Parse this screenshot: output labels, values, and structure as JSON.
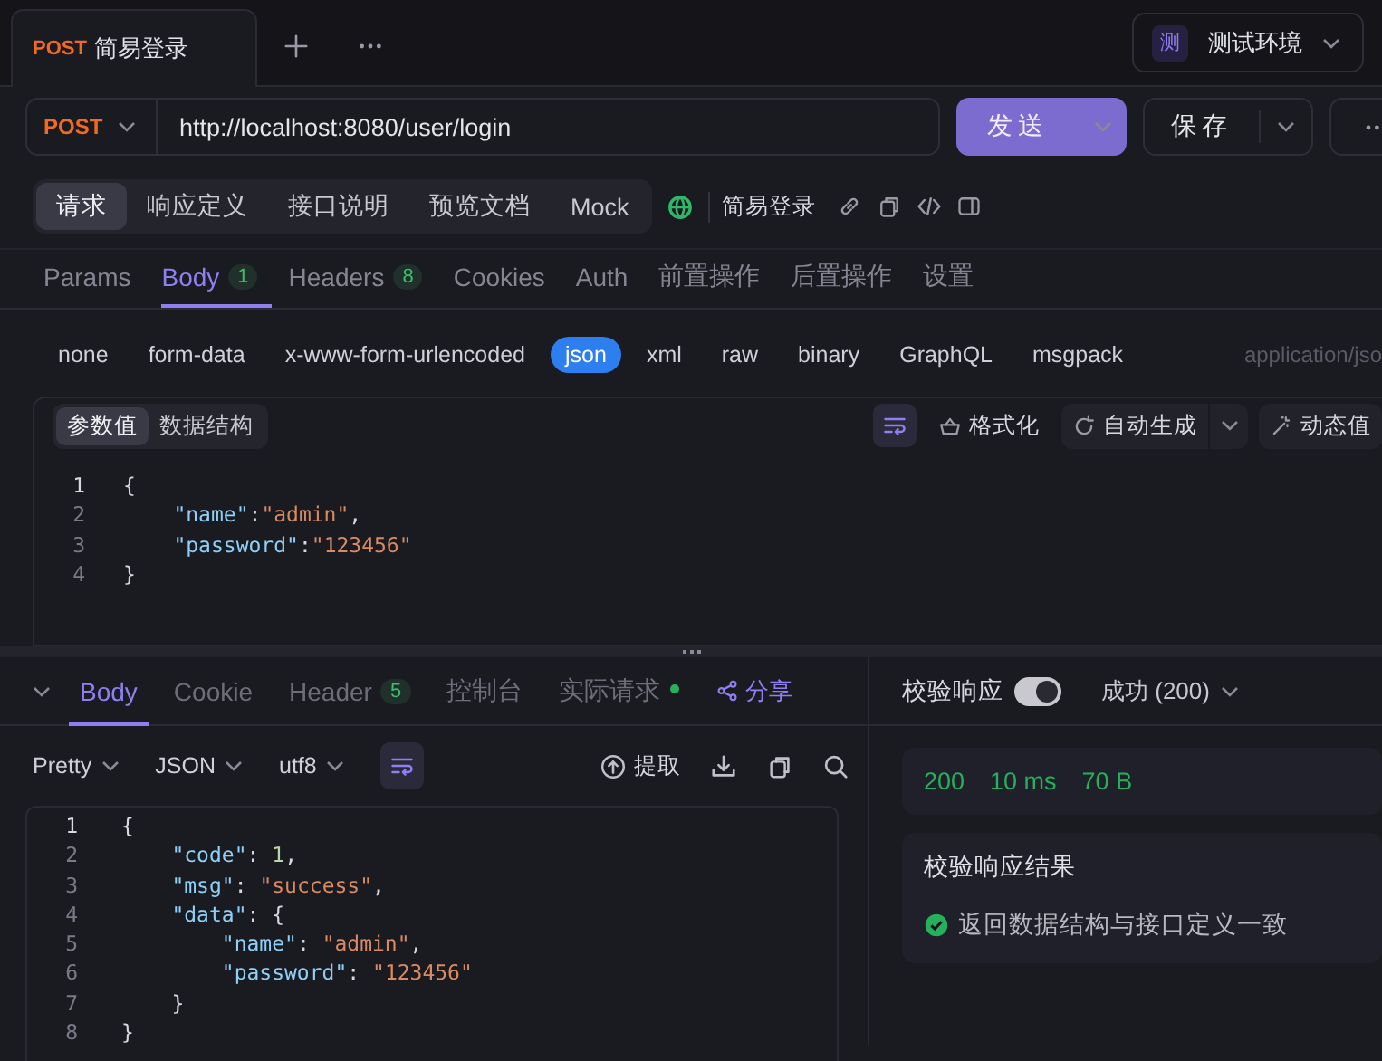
{
  "tabs": [
    {
      "method": "POST",
      "title": "简易登录",
      "selected": true
    }
  ],
  "environment": {
    "badge": "测",
    "name": "测试环境"
  },
  "request": {
    "method": "POST",
    "url": "http://localhost:8080/user/login",
    "send": "发送",
    "save": "保存"
  },
  "sections": [
    {
      "label": "请求",
      "selected": true
    },
    {
      "label": "响应定义",
      "selected": false
    },
    {
      "label": "接口说明",
      "selected": false
    },
    {
      "label": "预览文档",
      "selected": false
    },
    {
      "label": "Mock",
      "selected": false
    }
  ],
  "api_name": "简易登录",
  "param_tabs": [
    {
      "label": "Params",
      "selected": false
    },
    {
      "label": "Body",
      "badge": "1",
      "selected": true
    },
    {
      "label": "Headers",
      "badge": "8",
      "selected": false
    },
    {
      "label": "Cookies",
      "selected": false
    },
    {
      "label": "Auth",
      "selected": false
    },
    {
      "label": "前置操作",
      "selected": false
    },
    {
      "label": "后置操作",
      "selected": false
    },
    {
      "label": "设置",
      "selected": false
    }
  ],
  "body_types": [
    {
      "label": "none",
      "selected": false
    },
    {
      "label": "form-data",
      "selected": false
    },
    {
      "label": "x-www-form-urlencoded",
      "selected": false
    },
    {
      "label": "json",
      "selected": true
    },
    {
      "label": "xml",
      "selected": false
    },
    {
      "label": "raw",
      "selected": false
    },
    {
      "label": "binary",
      "selected": false
    },
    {
      "label": "GraphQL",
      "selected": false
    },
    {
      "label": "msgpack",
      "selected": false
    }
  ],
  "content_type": "application/jso",
  "editor": {
    "modes": [
      {
        "label": "参数值",
        "selected": true
      },
      {
        "label": "数据结构",
        "selected": false
      }
    ],
    "actions": [
      {
        "kind": "format",
        "label": "格式化"
      },
      {
        "kind": "generate",
        "label": "自动生成"
      },
      {
        "kind": "dynamic",
        "label": "动态值"
      }
    ],
    "lines": [
      {
        "n": "1",
        "text": "{"
      },
      {
        "n": "2",
        "text": "    \"name\":\"admin\","
      },
      {
        "n": "3",
        "text": "    \"password\":\"123456\""
      },
      {
        "n": "4",
        "text": "}"
      }
    ]
  },
  "response": {
    "tabs": [
      {
        "label": "Body",
        "selected": true
      },
      {
        "label": "Cookie",
        "selected": false
      },
      {
        "label": "Header",
        "badge": "5",
        "selected": false
      },
      {
        "label": "控制台",
        "selected": false
      },
      {
        "label": "实际请求",
        "indicator": true,
        "selected": false
      }
    ],
    "share": "分享",
    "format": "Pretty",
    "language": "JSON",
    "encoding": "utf8",
    "extract": "提取",
    "lines": [
      {
        "n": "1",
        "text": "{"
      },
      {
        "n": "2",
        "text": "    \"code\": 1,"
      },
      {
        "n": "3",
        "text": "    \"msg\": \"success\","
      },
      {
        "n": "4",
        "text": "    \"data\": {"
      },
      {
        "n": "5",
        "text": "        \"name\": \"admin\","
      },
      {
        "n": "6",
        "text": "        \"password\": \"123456\""
      },
      {
        "n": "7",
        "text": "    }"
      },
      {
        "n": "8",
        "text": "}"
      }
    ]
  },
  "validation": {
    "label": "校验响应",
    "on": true,
    "status": "成功 (200)",
    "metrics": [
      "200",
      "10 ms",
      "70 B"
    ],
    "result_title": "校验响应结果",
    "result": "返回数据结构与接口定义一致"
  }
}
